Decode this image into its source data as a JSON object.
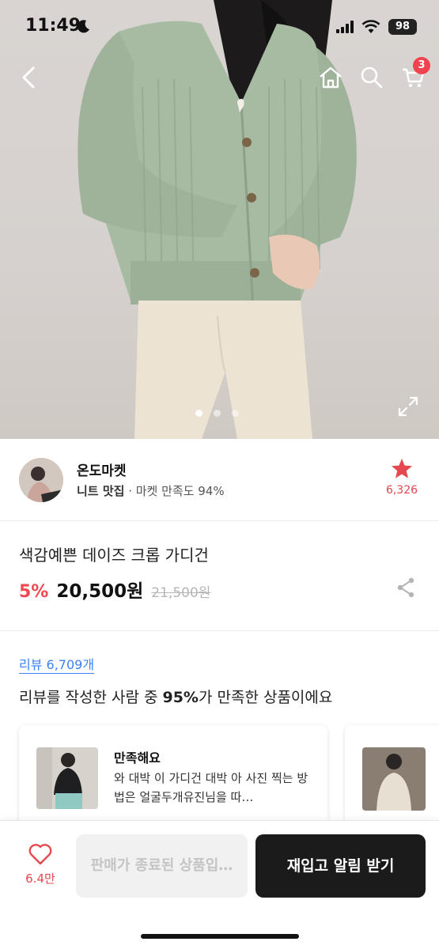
{
  "status_bar": {
    "time": "11:49",
    "battery": "98"
  },
  "nav": {
    "cart_count": "3"
  },
  "carousel": {
    "total": 3,
    "active": 1
  },
  "seller": {
    "name": "온도마켓",
    "category": "니트 맛집",
    "satisfaction": "· 마켓 만족도 94%",
    "favorites": "6,326"
  },
  "product": {
    "title": "색감예쁜 데이즈 크롭 가디건",
    "discount": "5%",
    "price": "20,500원",
    "original_price": "21,500원"
  },
  "reviews": {
    "link": "리뷰 6,709개",
    "summary_pre": "리뷰를 작성한 사람 중 ",
    "summary_pct": "95%",
    "summary_post": "가 만족한 상품이에요",
    "card": {
      "heading": "만족해요",
      "text": "와 대박 이 가디건 대박 아 사진 찍는 방법은 얼굴두개유진님을 따…"
    }
  },
  "bottom": {
    "likes": "6.4만",
    "disabled_label": "판매가 종료된 상품입…",
    "primary_label": "재입고 알림 받기"
  },
  "colors": {
    "accent": "#f0424f",
    "primary_button": "#1b1b1b",
    "link": "#3b82f6"
  }
}
